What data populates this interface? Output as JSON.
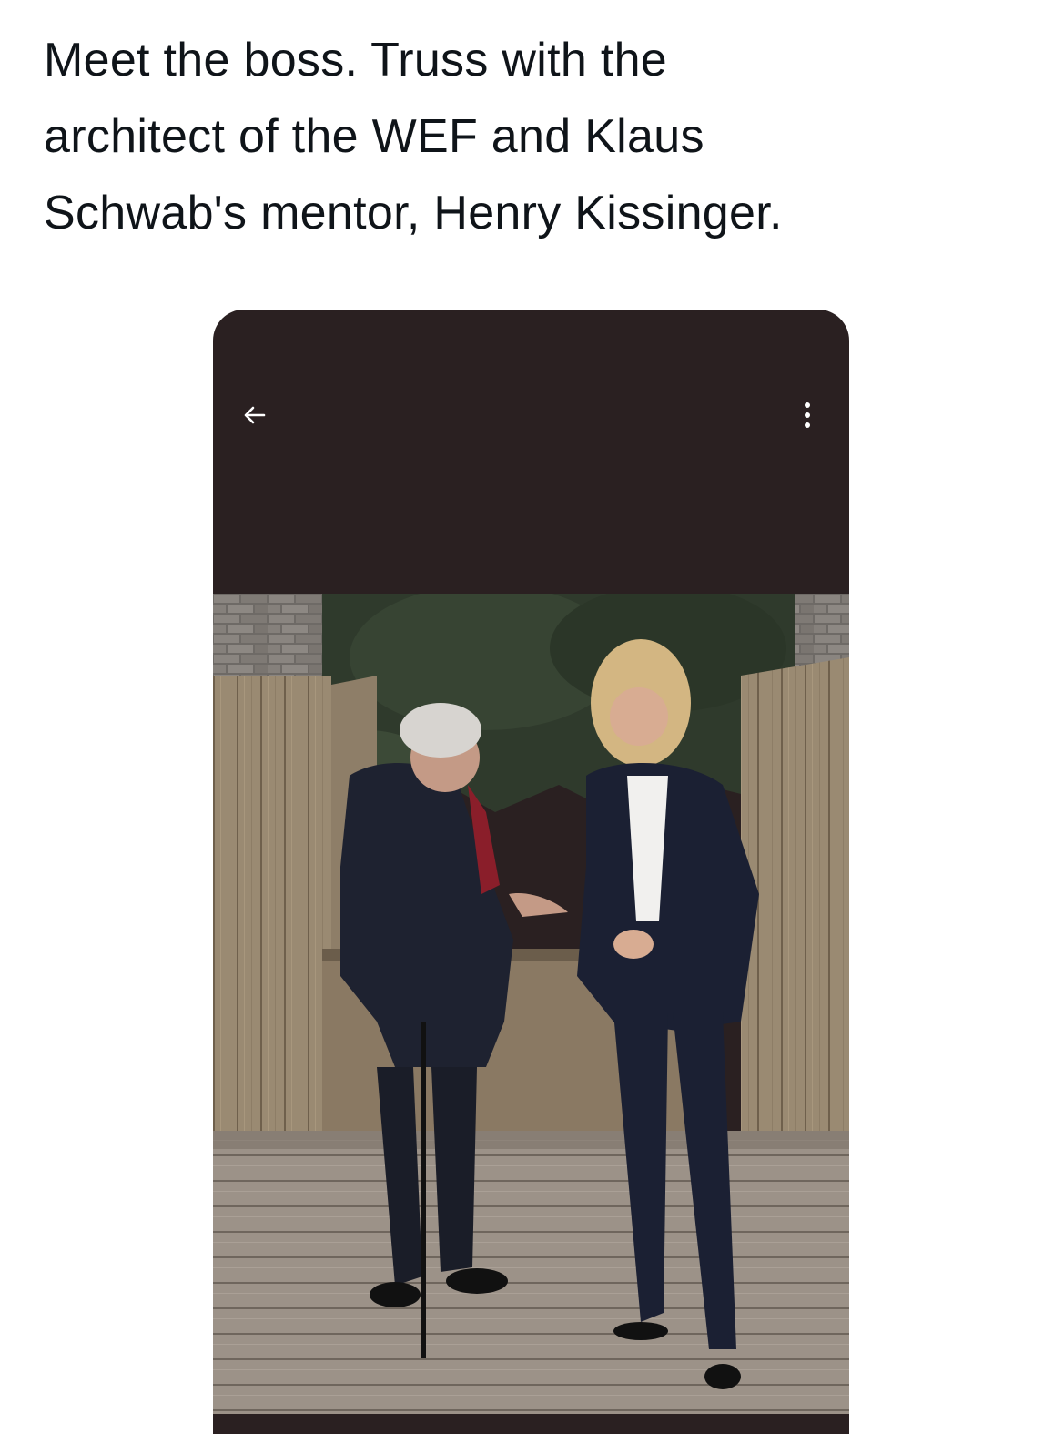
{
  "tweet": {
    "text": "Meet the boss. Truss with the\narchitect of the WEF and Klaus\nSchwab's mentor, Henry Kissinger."
  },
  "media_viewer": {
    "back_icon": "arrow-left-icon",
    "more_icon": "more-vertical-icon",
    "background_color": "#2a2021"
  }
}
